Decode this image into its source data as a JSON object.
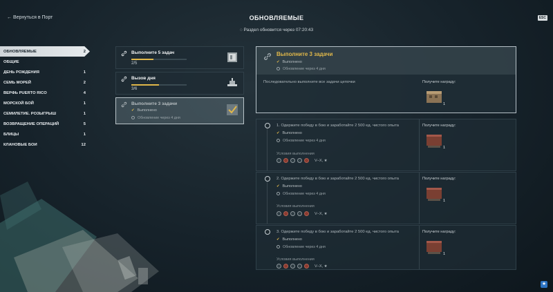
{
  "header": {
    "back_label": "← Вернуться в Порт",
    "title": "ОБНОВЛЯЕМЫЕ",
    "refresh_text": "Раздел обновится через 07:20:43",
    "esc_label": "ESC"
  },
  "sidebar": {
    "items": [
      {
        "label": "ОБНОВЛЯЕМЫЕ",
        "count": "2",
        "active": true
      },
      {
        "label": "ОБЩИЕ",
        "count": "",
        "active": false
      },
      {
        "label": "ДЕНЬ РОЖДЕНИЯ",
        "count": "1",
        "active": false
      },
      {
        "label": "СЕМЬ МОРЕЙ",
        "count": "2",
        "active": false
      },
      {
        "label": "ВЕРФЬ PUERTO RICO",
        "count": "4",
        "active": false
      },
      {
        "label": "МОРСКОЙ БОЙ",
        "count": "1",
        "active": false
      },
      {
        "label": "СЕМИЛЕТИЕ. РОЗЫГРЫШ",
        "count": "1",
        "active": false
      },
      {
        "label": "ВОЗВРАЩЕНИЕ ОПЕРАЦИЙ",
        "count": "5",
        "active": false
      },
      {
        "label": "БЛИЦЫ",
        "count": "1",
        "active": false
      },
      {
        "label": "КЛАНОВЫЕ БОИ",
        "count": "12",
        "active": false
      }
    ]
  },
  "tasks": [
    {
      "title": "Выполните 5 задач",
      "progress": "2/5",
      "progress_fraction": 0.4
    },
    {
      "title": "Вызов дня",
      "progress": "3/6",
      "progress_fraction": 0.5
    },
    {
      "title": "Выполните 3 задачи",
      "done_label": "Выполнено",
      "update_label": "Обновление через 4 дня"
    }
  ],
  "detail": {
    "title": "Выполните 3 задачи",
    "done_label": "Выполнено",
    "update_label": "Обновление через 4 дня",
    "description": "Последовательно выполните все задачи цепочки",
    "reward_label": "Получите награду:",
    "reward_qty": "1"
  },
  "chain": {
    "steps": [
      {
        "title": "1. Одержите победу в бою и заработайте 2 500 ед. чистого опыта",
        "done_label": "Выполнено",
        "update_label": "Обновление через 4 дня",
        "cond_label": "Условия выполнения",
        "tiers": "V–X, ★",
        "reward_label": "Получите награду:",
        "reward_qty": "1"
      },
      {
        "title": "2. Одержите победу в бою и заработайте 2 500 ед. чистого опыта",
        "done_label": "Выполнено",
        "update_label": "Обновление через 4 дня",
        "cond_label": "Условия выполнения",
        "tiers": "V–X, ★",
        "reward_label": "Получите награду:",
        "reward_qty": "1"
      },
      {
        "title": "3. Одержите победу в бою и заработайте 2 500 ед. чистого опыта",
        "done_label": "Выполнено",
        "update_label": "Обновление через 4 дня",
        "cond_label": "Условия выполнения",
        "tiers": "V–X, ★",
        "reward_label": "Получите награду:",
        "reward_qty": "1"
      }
    ]
  },
  "colors": {
    "accent": "#e1b84a",
    "active_tab": "#cfd5d9",
    "background": "#16222a"
  }
}
